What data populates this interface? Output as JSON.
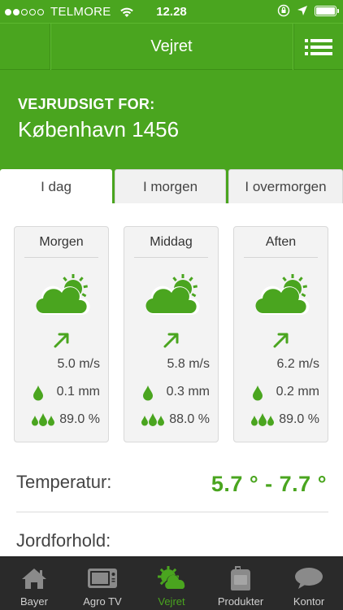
{
  "status_bar": {
    "carrier": "TELMORE",
    "time": "12.28"
  },
  "nav": {
    "title": "Vejret",
    "menu_icon": "list-menu-icon"
  },
  "header": {
    "label": "VEJRUDSIGT FOR:",
    "location": "København 1456"
  },
  "tabs": [
    {
      "label": "I dag",
      "active": true
    },
    {
      "label": "I morgen",
      "active": false
    },
    {
      "label": "I overmorgen",
      "active": false
    }
  ],
  "forecast": [
    {
      "period": "Morgen",
      "wind": "5.0 m/s",
      "rain": "0.1 mm",
      "humidity": "89.0 %"
    },
    {
      "period": "Middag",
      "wind": "5.8 m/s",
      "rain": "0.3 mm",
      "humidity": "88.0 %"
    },
    {
      "period": "Aften",
      "wind": "6.2 m/s",
      "rain": "0.2 mm",
      "humidity": "89.0 %"
    }
  ],
  "temperature": {
    "label": "Temperatur:",
    "value": "5.7 ° - 7.7 °"
  },
  "soil": {
    "label": "Jordforhold:"
  },
  "tabbar": [
    {
      "label": "Bayer",
      "icon": "home-icon",
      "active": false
    },
    {
      "label": "Agro TV",
      "icon": "tv-icon",
      "active": false
    },
    {
      "label": "Vejret",
      "icon": "weather-icon",
      "active": true
    },
    {
      "label": "Produkter",
      "icon": "product-can-icon",
      "active": false
    },
    {
      "label": "Kontor",
      "icon": "chat-bubble-icon",
      "active": false
    }
  ],
  "colors": {
    "brand_green": "#4aa51f",
    "tabbar_bg": "#2a2a2a"
  }
}
